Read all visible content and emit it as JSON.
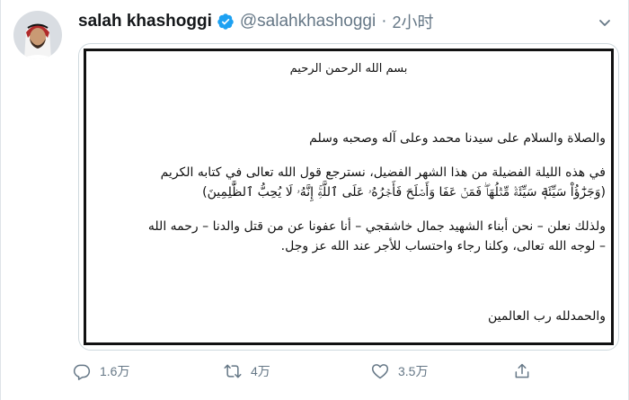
{
  "tweet": {
    "display_name": "salah khashoggi",
    "handle": "@salahkhashoggi",
    "separator": "·",
    "time": "2小时",
    "verified_icon": "verified-badge-icon",
    "menu_icon": "chevron-down-icon"
  },
  "letter": {
    "basmala": "بسم الله الرحمن الرحيم",
    "greeting": "والصلاة والسلام على سيدنا محمد وعلى آله وصحبه وسلم",
    "paragraph2_line1": "في هذه الليلة الفضيلة من هذا الشهر الفضيل، نسترجع قول الله تعالى في كتابه الكريم",
    "paragraph2_line2": "(وَجَزَٰٓؤُاْ سَيِّئَةٖ سَيِّئَةٞ مِّثۡلُهَاۖ فَمَنۡ عَفَا وَأَصۡلَحَ فَأَجۡرُهُۥ عَلَى ٱللَّهِۚ إِنَّهُۥ لَا يُحِبُّ ٱلظَّٰلِمِينَ)",
    "paragraph3_line1": "ولذلك نعلن – نحن أبناء الشهيد جمال خاشقجي – أنا عفونا عن من قتل والدنا – رحمه الله",
    "paragraph3_line2": "– لوجه الله تعالى، وكلنا رجاء واحتساب للأجر عند الله عز وجل.",
    "closing": "والحمدلله رب العالمين"
  },
  "actions": {
    "reply": {
      "icon": "reply-icon",
      "count": "1.6万"
    },
    "retweet": {
      "icon": "retweet-icon",
      "count": "4万"
    },
    "like": {
      "icon": "like-icon",
      "count": "3.5万"
    },
    "share": {
      "icon": "share-icon"
    }
  },
  "colors": {
    "text_primary": "#14171a",
    "text_secondary": "#657786",
    "verified_blue": "#1da1f2"
  }
}
